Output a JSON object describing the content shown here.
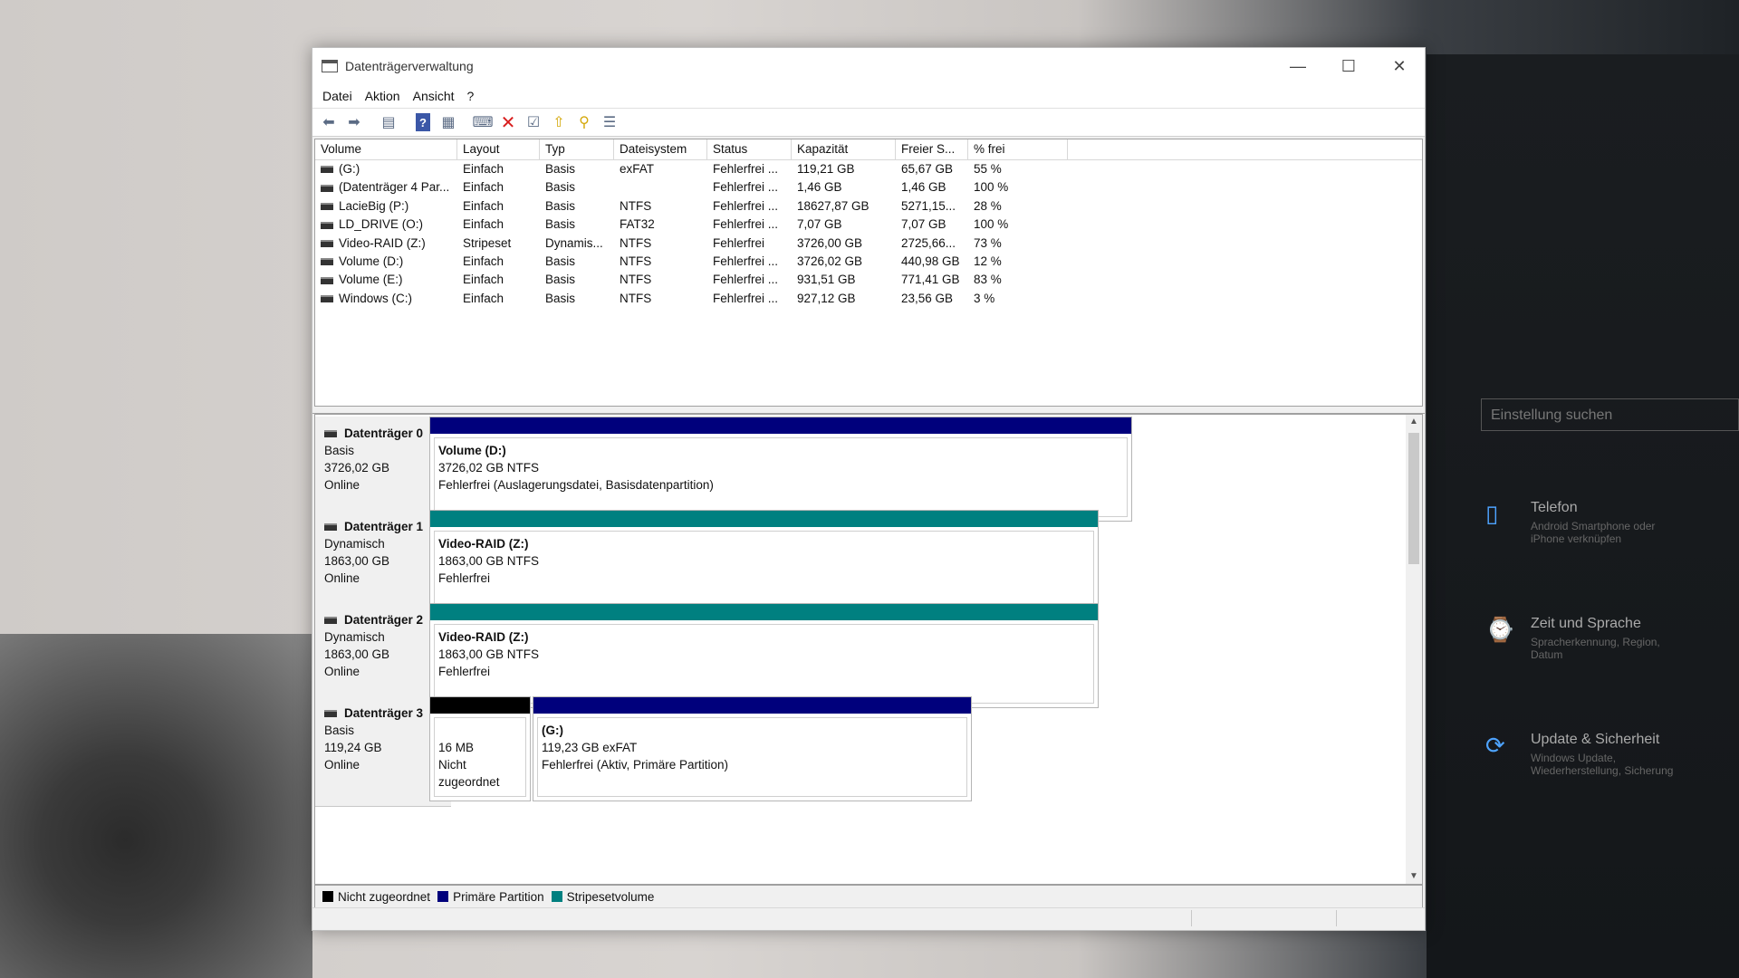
{
  "window": {
    "title": "Datenträgerverwaltung",
    "controls": {
      "minimize": "—",
      "maximize": "☐",
      "close": "✕"
    }
  },
  "menu": {
    "file": "Datei",
    "action": "Aktion",
    "view": "Ansicht",
    "help": "?"
  },
  "list": {
    "headers": [
      "Volume",
      "Layout",
      "Typ",
      "Dateisystem",
      "Status",
      "Kapazität",
      "Freier S...",
      "% frei"
    ],
    "rows": [
      [
        "(G:)",
        "Einfach",
        "Basis",
        "exFAT",
        "Fehlerfrei ...",
        "119,21 GB",
        "65,67 GB",
        "55 %"
      ],
      [
        "(Datenträger 4 Par...",
        "Einfach",
        "Basis",
        "",
        "Fehlerfrei ...",
        "1,46 GB",
        "1,46 GB",
        "100 %"
      ],
      [
        "LacieBig (P:)",
        "Einfach",
        "Basis",
        "NTFS",
        "Fehlerfrei ...",
        "18627,87 GB",
        "5271,15...",
        "28 %"
      ],
      [
        "LD_DRIVE (O:)",
        "Einfach",
        "Basis",
        "FAT32",
        "Fehlerfrei ...",
        "7,07 GB",
        "7,07 GB",
        "100 %"
      ],
      [
        "Video-RAID (Z:)",
        "Stripeset",
        "Dynamis...",
        "NTFS",
        "Fehlerfrei",
        "3726,00 GB",
        "2725,66...",
        "73 %"
      ],
      [
        "Volume (D:)",
        "Einfach",
        "Basis",
        "NTFS",
        "Fehlerfrei ...",
        "3726,02 GB",
        "440,98 GB",
        "12 %"
      ],
      [
        "Volume (E:)",
        "Einfach",
        "Basis",
        "NTFS",
        "Fehlerfrei ...",
        "931,51 GB",
        "771,41 GB",
        "83 %"
      ],
      [
        "Windows (C:)",
        "Einfach",
        "Basis",
        "NTFS",
        "Fehlerfrei ...",
        "927,12 GB",
        "23,56 GB",
        "3 %"
      ]
    ]
  },
  "disks": [
    {
      "name": "Datenträger 0",
      "type": "Basis",
      "size": "3726,02 GB",
      "state": "Online",
      "partitions": [
        {
          "name": "Volume  (D:)",
          "size": "3726,02 GB NTFS",
          "status": "Fehlerfrei (Auslagerungsdatei, Basisdatenpartition)",
          "bar": "primary"
        }
      ]
    },
    {
      "name": "Datenträger 1",
      "type": "Dynamisch",
      "size": "1863,00 GB",
      "state": "Online",
      "partitions": [
        {
          "name": "Video-RAID  (Z:)",
          "size": "1863,00 GB NTFS",
          "status": "Fehlerfrei",
          "bar": "stripe"
        }
      ]
    },
    {
      "name": "Datenträger 2",
      "type": "Dynamisch",
      "size": "1863,00 GB",
      "state": "Online",
      "partitions": [
        {
          "name": "Video-RAID  (Z:)",
          "size": "1863,00 GB NTFS",
          "status": "Fehlerfrei",
          "bar": "stripe"
        }
      ]
    },
    {
      "name": "Datenträger 3",
      "type": "Basis",
      "size": "119,24 GB",
      "state": "Online",
      "partitions": [
        {
          "name": "",
          "size": "16 MB",
          "status": "Nicht zugeordnet",
          "bar": "unallocated"
        },
        {
          "name": "(G:)",
          "size": "119,23 GB exFAT",
          "status": "Fehlerfrei (Aktiv, Primäre Partition)",
          "bar": "primary"
        }
      ]
    }
  ],
  "legend": {
    "unallocated": "Nicht zugeordnet",
    "primary": "Primäre Partition",
    "stripe": "Stripesetvolume"
  },
  "colors": {
    "unallocated": "#000000",
    "primary": "#00007c",
    "stripe": "#008080"
  },
  "background": {
    "search_placeholder": "Einstellung suchen",
    "settings": [
      {
        "title": "Telefon",
        "sub": "Android Smartphone oder iPhone verknüpfen"
      },
      {
        "title": "Zeit und Sprache",
        "sub": "Spracherkennung, Region, Datum"
      },
      {
        "title": "Update & Sicherheit",
        "sub": "Windows Update, Wiederherstellung, Sicherung"
      }
    ]
  }
}
